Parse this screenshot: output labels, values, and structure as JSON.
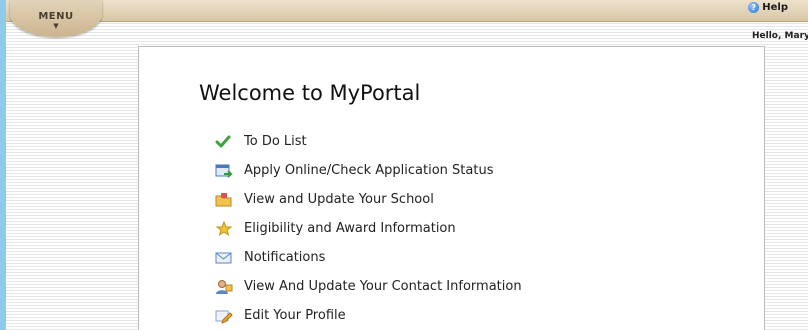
{
  "header": {
    "menu_label": "MENU",
    "menu_caret": "▼",
    "help_label": "Help",
    "help_icon_glyph": "?",
    "greeting": "Hello, Mary"
  },
  "main": {
    "title": "Welcome to MyPortal",
    "items": [
      {
        "label": "To Do List",
        "icon": "checkmark-icon"
      },
      {
        "label": "Apply Online/Check Application Status",
        "icon": "application-icon"
      },
      {
        "label": "View and Update Your School",
        "icon": "school-folder-icon"
      },
      {
        "label": "Eligibility and Award Information",
        "icon": "award-icon"
      },
      {
        "label": "Notifications",
        "icon": "envelope-icon"
      },
      {
        "label": "View And Update Your Contact Information",
        "icon": "contact-icon"
      },
      {
        "label": "Edit Your Profile",
        "icon": "edit-profile-icon"
      }
    ]
  },
  "colors": {
    "page_background": "#8ecbea",
    "topbar": "#ddcbab",
    "panel": "#ffffff"
  }
}
